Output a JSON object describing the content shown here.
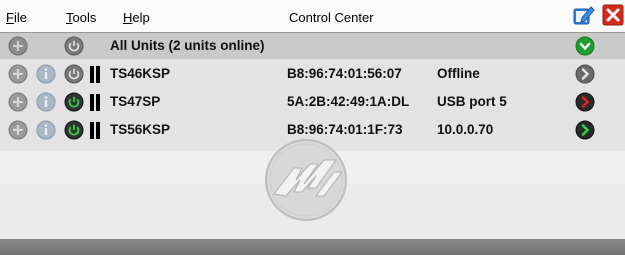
{
  "window": {
    "title": "Control Center"
  },
  "menu": [
    {
      "first": "F",
      "rest": "ile"
    },
    {
      "first": "T",
      "rest": "ools"
    },
    {
      "first": "H",
      "rest": "elp"
    }
  ],
  "header": {
    "label": "All Units (2 units online)"
  },
  "units": [
    {
      "name": "TS46KSP",
      "mac": "B8:96:74:01:56:07",
      "status": "Offline",
      "power": "off",
      "connect": "gray"
    },
    {
      "name": "TS47SP",
      "mac": "5A:2B:42:49:1A:DL",
      "status": "USB port 5",
      "power": "on",
      "connect": "red"
    },
    {
      "name": "TS56KSP",
      "mac": "B8:96:74:01:1F:73",
      "status": "10.0.0.70",
      "power": "on",
      "connect": "green"
    }
  ],
  "colors": {
    "accent_green": "#1e9e2e",
    "accent_red": "#c81818",
    "header_bg": "#c9c9c9",
    "list_bg": "#e3e3e3"
  }
}
